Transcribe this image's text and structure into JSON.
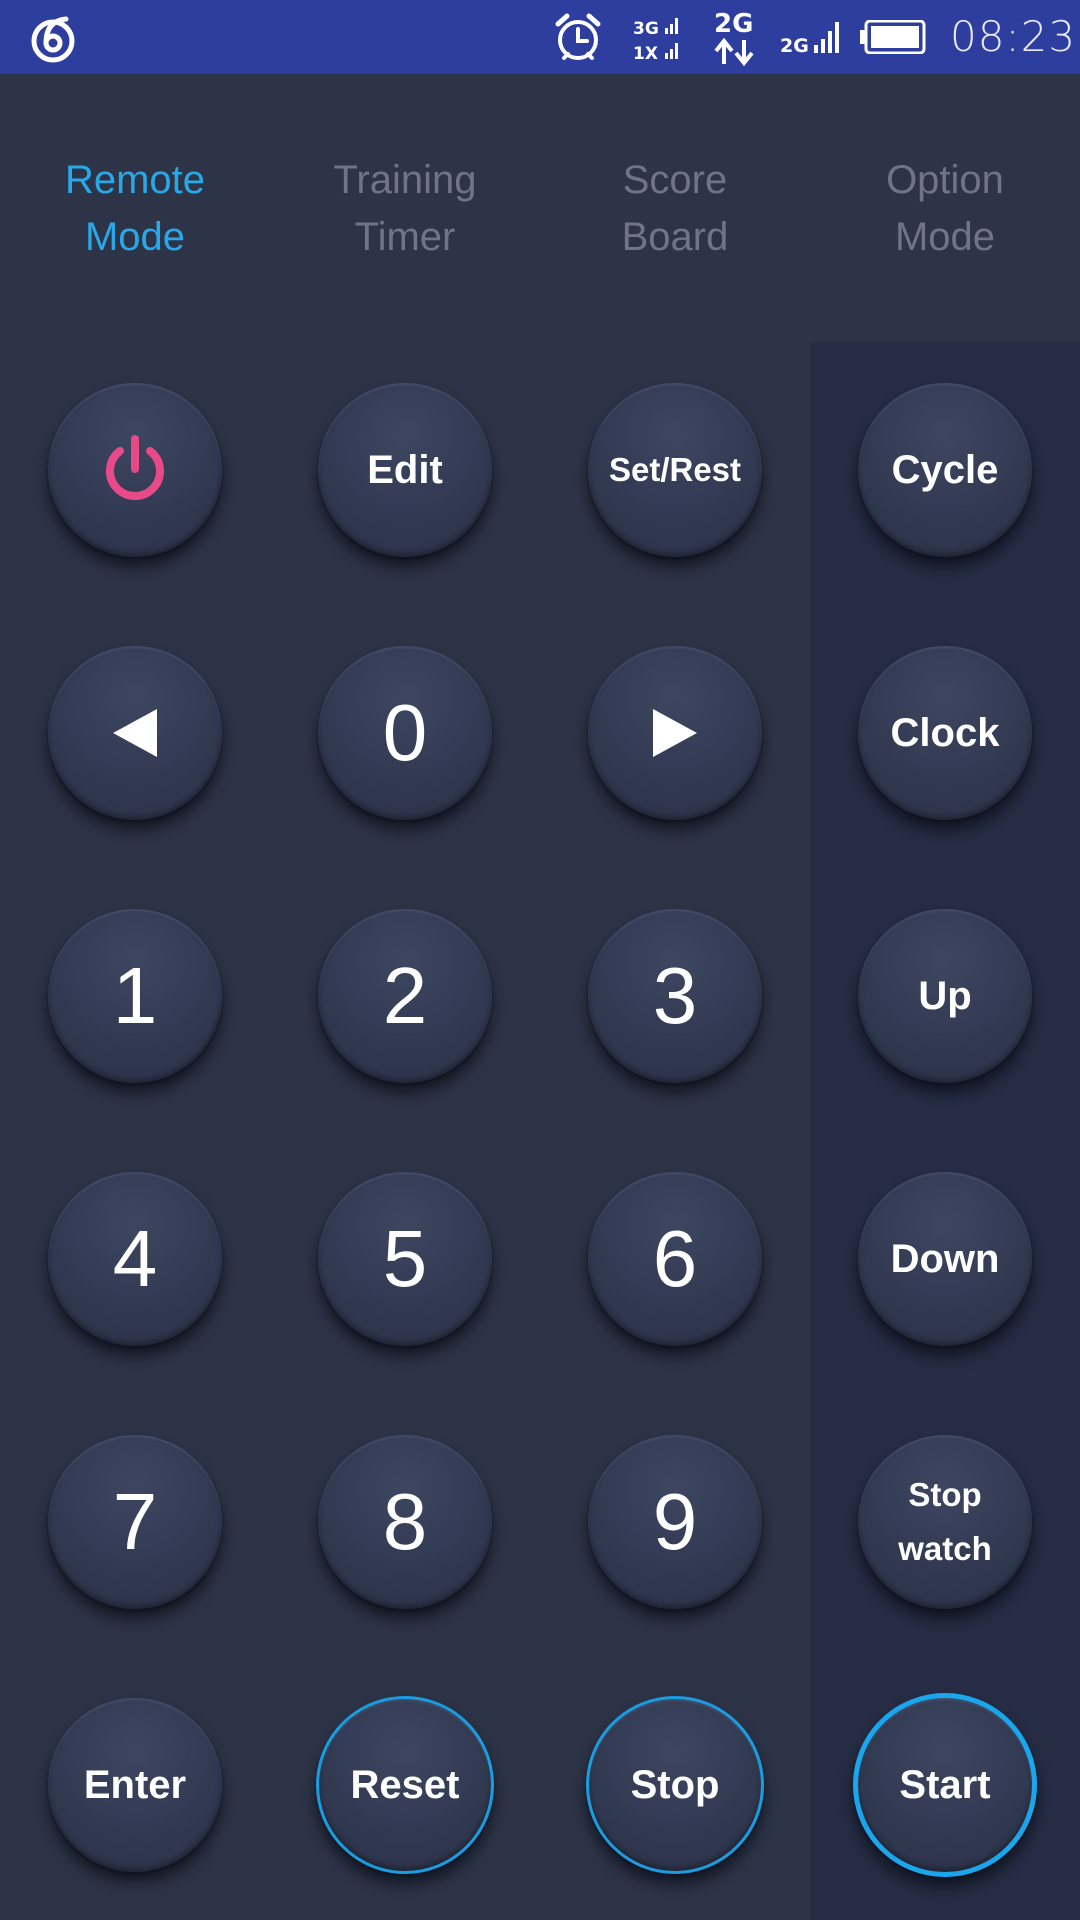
{
  "status_bar": {
    "icons": [
      "app-logo-icon",
      "alarm-clock-icon",
      "network-3g-1x-icon",
      "network-2g-data-icon",
      "signal-2g-icon",
      "battery-icon"
    ],
    "time": "08:23",
    "network_3g": "3G",
    "network_1x": "1X",
    "network_2g_data": "2G",
    "network_2g_signal": "2G",
    "color": "#2e3e9e"
  },
  "tabs": [
    {
      "label": "Remote\nMode",
      "active": true
    },
    {
      "label": "Training\nTimer",
      "active": false
    },
    {
      "label": "Score\nBoard",
      "active": false
    },
    {
      "label": "Option\nMode",
      "active": false
    }
  ],
  "colors": {
    "accent": "#29a8e8",
    "power": "#e84a88",
    "background": "#2d3447",
    "side_panel": "#262d44"
  },
  "keypad": {
    "power_icon": "power-icon",
    "edit": "Edit",
    "set_rest": "Set/Rest",
    "cycle": "Cycle",
    "left_icon": "arrow-left-icon",
    "zero": "0",
    "right_icon": "arrow-right-icon",
    "clock": "Clock",
    "one": "1",
    "two": "2",
    "three": "3",
    "up": "Up",
    "four": "4",
    "five": "5",
    "six": "6",
    "down": "Down",
    "seven": "7",
    "eight": "8",
    "nine": "9",
    "stopwatch": "Stop\nwatch",
    "enter": "Enter",
    "reset": "Reset",
    "stop": "Stop",
    "start": "Start"
  }
}
